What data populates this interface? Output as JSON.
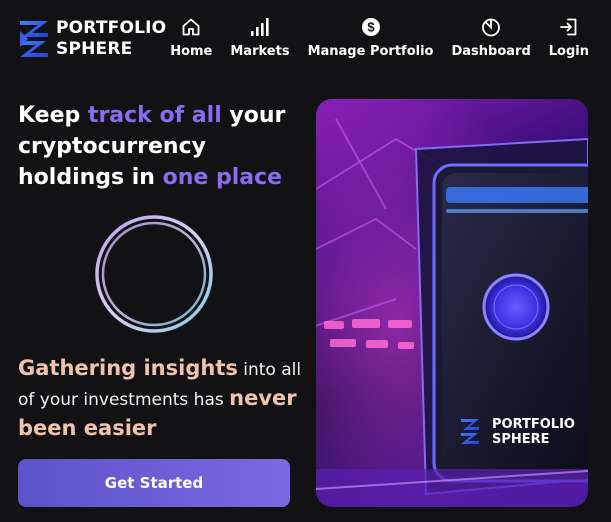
{
  "brand": {
    "line1": "PORTFOLIO",
    "line2": "SPHERE",
    "logo_icon": "stacked-chevrons-logo"
  },
  "nav": [
    {
      "label": "Home",
      "icon": "home-icon"
    },
    {
      "label": "Markets",
      "icon": "signal-bars-icon"
    },
    {
      "label": "Manage Portfolio",
      "icon": "dollar-coin-icon"
    },
    {
      "label": "Dashboard",
      "icon": "pie-chart-icon"
    },
    {
      "label": "Login",
      "icon": "login-icon"
    }
  ],
  "hero": {
    "headline_a": "Keep ",
    "headline_b": "track of all",
    "headline_c": " your cryptocurrency holdings in ",
    "headline_d": "one place",
    "sub_a": "Gathering insights",
    "sub_b": " into all of your investments has ",
    "sub_c": "never been easier",
    "cta_label": "Get Started",
    "art_brand_line1": "PORTFOLIO",
    "art_brand_line2": "SPHERE"
  },
  "colors": {
    "background": "#121214",
    "accent_purple": "#8b6cf1",
    "accent_peach": "#f1c3ad",
    "button_start": "#5b53c9",
    "button_end": "#7a69e2"
  }
}
